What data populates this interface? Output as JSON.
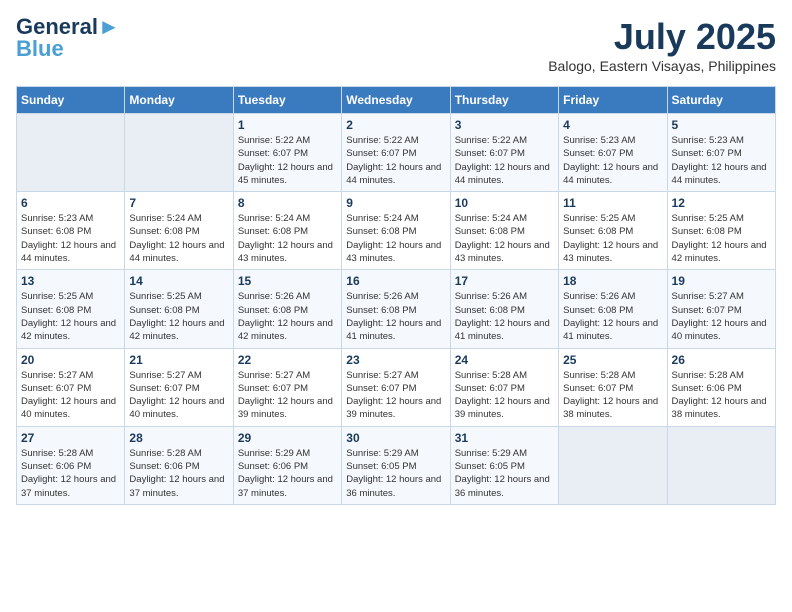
{
  "logo": {
    "line1a": "General",
    "line1b": "Blue",
    "line2": "Blue"
  },
  "header": {
    "month": "July 2025",
    "location": "Balogo, Eastern Visayas, Philippines"
  },
  "weekdays": [
    "Sunday",
    "Monday",
    "Tuesday",
    "Wednesday",
    "Thursday",
    "Friday",
    "Saturday"
  ],
  "weeks": [
    [
      {
        "day": "",
        "info": ""
      },
      {
        "day": "",
        "info": ""
      },
      {
        "day": "1",
        "info": "Sunrise: 5:22 AM\nSunset: 6:07 PM\nDaylight: 12 hours and 45 minutes."
      },
      {
        "day": "2",
        "info": "Sunrise: 5:22 AM\nSunset: 6:07 PM\nDaylight: 12 hours and 44 minutes."
      },
      {
        "day": "3",
        "info": "Sunrise: 5:22 AM\nSunset: 6:07 PM\nDaylight: 12 hours and 44 minutes."
      },
      {
        "day": "4",
        "info": "Sunrise: 5:23 AM\nSunset: 6:07 PM\nDaylight: 12 hours and 44 minutes."
      },
      {
        "day": "5",
        "info": "Sunrise: 5:23 AM\nSunset: 6:07 PM\nDaylight: 12 hours and 44 minutes."
      }
    ],
    [
      {
        "day": "6",
        "info": "Sunrise: 5:23 AM\nSunset: 6:08 PM\nDaylight: 12 hours and 44 minutes."
      },
      {
        "day": "7",
        "info": "Sunrise: 5:24 AM\nSunset: 6:08 PM\nDaylight: 12 hours and 44 minutes."
      },
      {
        "day": "8",
        "info": "Sunrise: 5:24 AM\nSunset: 6:08 PM\nDaylight: 12 hours and 43 minutes."
      },
      {
        "day": "9",
        "info": "Sunrise: 5:24 AM\nSunset: 6:08 PM\nDaylight: 12 hours and 43 minutes."
      },
      {
        "day": "10",
        "info": "Sunrise: 5:24 AM\nSunset: 6:08 PM\nDaylight: 12 hours and 43 minutes."
      },
      {
        "day": "11",
        "info": "Sunrise: 5:25 AM\nSunset: 6:08 PM\nDaylight: 12 hours and 43 minutes."
      },
      {
        "day": "12",
        "info": "Sunrise: 5:25 AM\nSunset: 6:08 PM\nDaylight: 12 hours and 42 minutes."
      }
    ],
    [
      {
        "day": "13",
        "info": "Sunrise: 5:25 AM\nSunset: 6:08 PM\nDaylight: 12 hours and 42 minutes."
      },
      {
        "day": "14",
        "info": "Sunrise: 5:25 AM\nSunset: 6:08 PM\nDaylight: 12 hours and 42 minutes."
      },
      {
        "day": "15",
        "info": "Sunrise: 5:26 AM\nSunset: 6:08 PM\nDaylight: 12 hours and 42 minutes."
      },
      {
        "day": "16",
        "info": "Sunrise: 5:26 AM\nSunset: 6:08 PM\nDaylight: 12 hours and 41 minutes."
      },
      {
        "day": "17",
        "info": "Sunrise: 5:26 AM\nSunset: 6:08 PM\nDaylight: 12 hours and 41 minutes."
      },
      {
        "day": "18",
        "info": "Sunrise: 5:26 AM\nSunset: 6:08 PM\nDaylight: 12 hours and 41 minutes."
      },
      {
        "day": "19",
        "info": "Sunrise: 5:27 AM\nSunset: 6:07 PM\nDaylight: 12 hours and 40 minutes."
      }
    ],
    [
      {
        "day": "20",
        "info": "Sunrise: 5:27 AM\nSunset: 6:07 PM\nDaylight: 12 hours and 40 minutes."
      },
      {
        "day": "21",
        "info": "Sunrise: 5:27 AM\nSunset: 6:07 PM\nDaylight: 12 hours and 40 minutes."
      },
      {
        "day": "22",
        "info": "Sunrise: 5:27 AM\nSunset: 6:07 PM\nDaylight: 12 hours and 39 minutes."
      },
      {
        "day": "23",
        "info": "Sunrise: 5:27 AM\nSunset: 6:07 PM\nDaylight: 12 hours and 39 minutes."
      },
      {
        "day": "24",
        "info": "Sunrise: 5:28 AM\nSunset: 6:07 PM\nDaylight: 12 hours and 39 minutes."
      },
      {
        "day": "25",
        "info": "Sunrise: 5:28 AM\nSunset: 6:07 PM\nDaylight: 12 hours and 38 minutes."
      },
      {
        "day": "26",
        "info": "Sunrise: 5:28 AM\nSunset: 6:06 PM\nDaylight: 12 hours and 38 minutes."
      }
    ],
    [
      {
        "day": "27",
        "info": "Sunrise: 5:28 AM\nSunset: 6:06 PM\nDaylight: 12 hours and 37 minutes."
      },
      {
        "day": "28",
        "info": "Sunrise: 5:28 AM\nSunset: 6:06 PM\nDaylight: 12 hours and 37 minutes."
      },
      {
        "day": "29",
        "info": "Sunrise: 5:29 AM\nSunset: 6:06 PM\nDaylight: 12 hours and 37 minutes."
      },
      {
        "day": "30",
        "info": "Sunrise: 5:29 AM\nSunset: 6:05 PM\nDaylight: 12 hours and 36 minutes."
      },
      {
        "day": "31",
        "info": "Sunrise: 5:29 AM\nSunset: 6:05 PM\nDaylight: 12 hours and 36 minutes."
      },
      {
        "day": "",
        "info": ""
      },
      {
        "day": "",
        "info": ""
      }
    ]
  ]
}
